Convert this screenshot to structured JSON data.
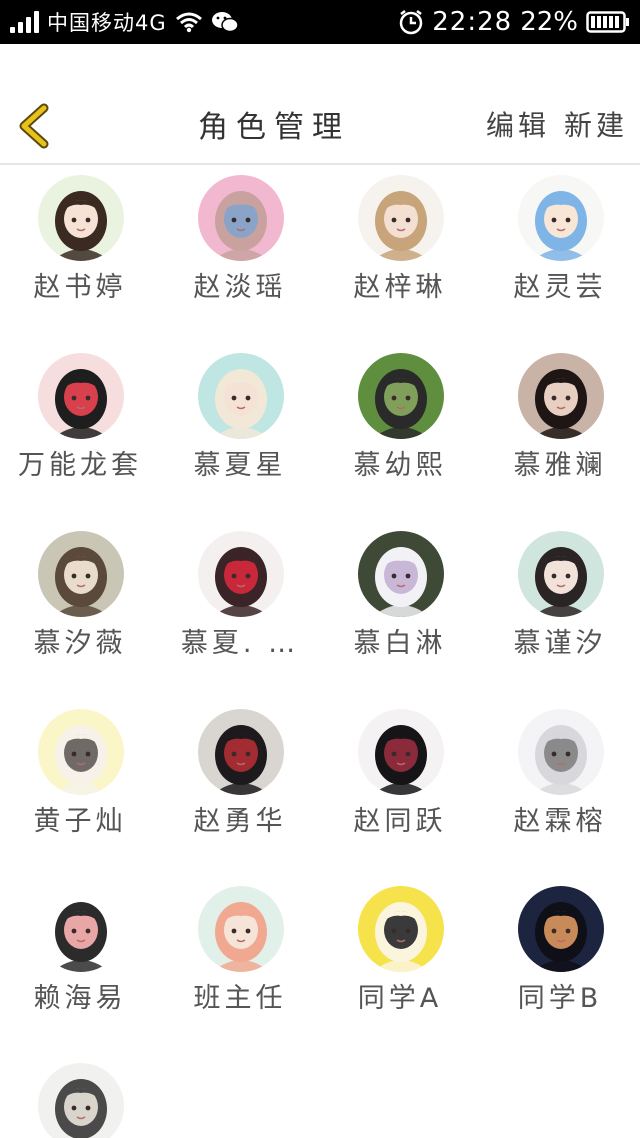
{
  "status_bar": {
    "carrier": "中国移动4G",
    "time": "22:28",
    "battery": "22%",
    "icons": [
      "signal-icon",
      "wifi-icon",
      "wechat-icon",
      "alarm-icon",
      "battery-icon"
    ]
  },
  "header": {
    "title": "角色管理",
    "edit_label": "编辑",
    "new_label": "新建",
    "back_icon": "chevron-left-icon",
    "accent_color": "#e8c21a"
  },
  "roles": [
    {
      "name": "赵书婷",
      "avatar_colors": [
        "#eaf3e0",
        "#3a2a22",
        "#f7e3d6"
      ]
    },
    {
      "name": "赵淡瑶",
      "avatar_colors": [
        "#f2b8cf",
        "#c9a2a0",
        "#8aa3c8"
      ]
    },
    {
      "name": "赵梓琳",
      "avatar_colors": [
        "#f6f3ee",
        "#c7a47a",
        "#f4e0d2"
      ]
    },
    {
      "name": "赵灵芸",
      "avatar_colors": [
        "#f7f7f5",
        "#7fb4e6",
        "#f8e6d6"
      ]
    },
    {
      "name": "万能龙套",
      "avatar_colors": [
        "#f6dede",
        "#1e1e1e",
        "#d9404d"
      ]
    },
    {
      "name": "慕夏星",
      "avatar_colors": [
        "#bfe6e2",
        "#f2e8d8",
        "#f4e2d6"
      ]
    },
    {
      "name": "慕幼熙",
      "avatar_colors": [
        "#5f8f3e",
        "#2a2a2a",
        "#7f9f5a"
      ]
    },
    {
      "name": "慕雅斓",
      "avatar_colors": [
        "#c9b3a7",
        "#1d1614",
        "#e7cfc1"
      ]
    },
    {
      "name": "慕汐薇",
      "avatar_colors": [
        "#c9c6b6",
        "#5b4a3c",
        "#e9dccc"
      ]
    },
    {
      "name": "慕夏. …",
      "avatar_colors": [
        "#f4f0f0",
        "#3a2428",
        "#c8283a"
      ]
    },
    {
      "name": "慕白淋",
      "avatar_colors": [
        "#3f4a36",
        "#f2f2f6",
        "#c9b7d8"
      ]
    },
    {
      "name": "慕谨汐",
      "avatar_colors": [
        "#cfe5de",
        "#2b2424",
        "#f2e3da"
      ]
    },
    {
      "name": "黄子灿",
      "avatar_colors": [
        "#fbf6c8",
        "#f6f2ea",
        "#6f6a66"
      ]
    },
    {
      "name": "赵勇华",
      "avatar_colors": [
        "#d9d6d2",
        "#1c1a1c",
        "#a32c33"
      ]
    },
    {
      "name": "赵同跃",
      "avatar_colors": [
        "#f4f2f2",
        "#151518",
        "#8a2a3a"
      ]
    },
    {
      "name": "赵霖榕",
      "avatar_colors": [
        "#f4f4f6",
        "#d8d8dc",
        "#8a8a8a"
      ]
    },
    {
      "name": "赖海易",
      "avatar_colors": [
        "#ffffff",
        "#2b2b2b",
        "#e8a6a6"
      ]
    },
    {
      "name": "班主任",
      "avatar_colors": [
        "#e2f0ea",
        "#f0a990",
        "#f7e4d8"
      ]
    },
    {
      "name": "同学A",
      "avatar_colors": [
        "#f6e24a",
        "#fbf5dd",
        "#3a3a3a"
      ]
    },
    {
      "name": "同学B",
      "avatar_colors": [
        "#1c2440",
        "#0f0f18",
        "#c98a5a"
      ]
    },
    {
      "name": "",
      "avatar_colors": [
        "#f1f1ef",
        "#4a4a4a",
        "#d9d4cc"
      ]
    }
  ]
}
